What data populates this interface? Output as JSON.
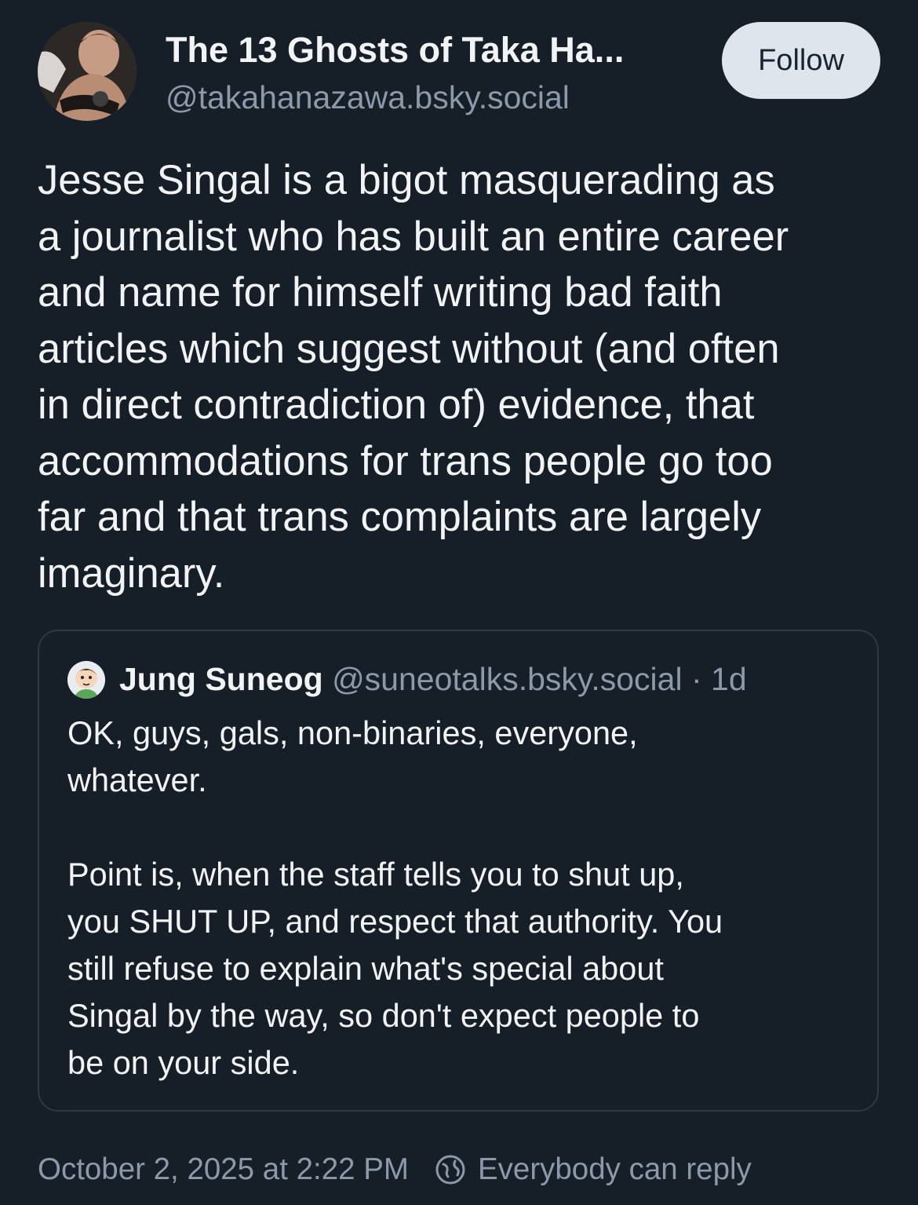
{
  "author": {
    "display_name": "The 13 Ghosts of Taka Ha...",
    "handle": "@takahanazawa.bsky.social",
    "avatar_icon": "profile-photo"
  },
  "follow_button": {
    "label": "Follow"
  },
  "post": {
    "text": "Jesse Singal is a bigot masquerading as\na journalist who has built an entire career\nand name for himself writing bad faith\narticles which suggest without (and often\nin direct contradiction of) evidence, that\naccommodations for trans people go too\nfar and that trans complaints are largely\nimaginary."
  },
  "quote": {
    "display_name": "Jung Suneog",
    "handle": "@suneotalks.bsky.social",
    "separator": "·",
    "time": "1d",
    "avatar_icon": "cartoon-avatar",
    "text": "OK, guys, gals, non-binaries, everyone,\nwhatever.\n\nPoint is, when the staff tells you to shut up,\nyou SHUT UP, and respect that authority. You\nstill refuse to explain what's special about\nSingal by the way, so don't expect people to\nbe on your side."
  },
  "footer": {
    "timestamp": "October 2, 2025 at 2:22 PM",
    "reply_setting": "Everybody can reply",
    "reply_icon": "globe-icon"
  },
  "colors": {
    "background": "#161e27",
    "text_primary": "#f1f3f5",
    "text_secondary": "#8c99a8",
    "button_bg": "#dfe5ec",
    "border": "#2c3846"
  }
}
